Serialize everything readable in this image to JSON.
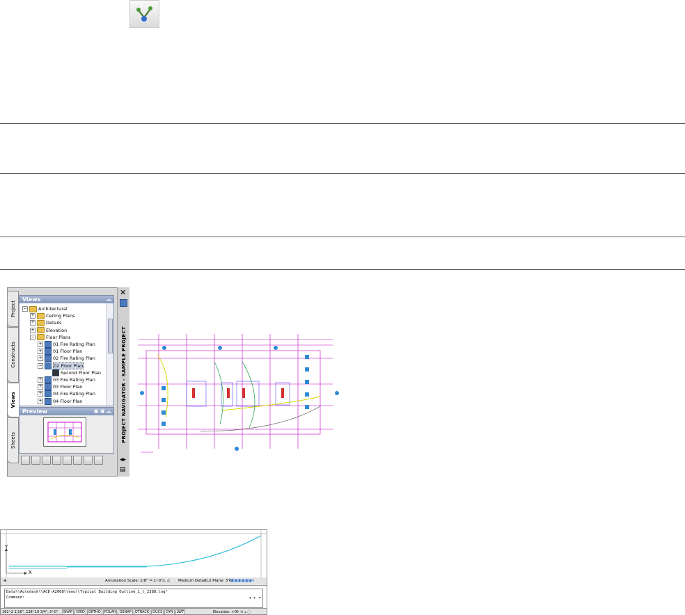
{
  "palette": {
    "tabs": [
      "Project",
      "Constructs",
      "Views",
      "Sheets"
    ],
    "active_tab": "Views",
    "views_header": "Views",
    "tree": [
      {
        "label": "Architectural",
        "indent": 0,
        "icon": "folder",
        "expander": "−"
      },
      {
        "label": "Ceiling Plans",
        "indent": 1,
        "icon": "folder",
        "expander": "+"
      },
      {
        "label": "Details",
        "indent": 1,
        "icon": "folder",
        "expander": "+"
      },
      {
        "label": "Elevation",
        "indent": 1,
        "icon": "folder",
        "expander": "+"
      },
      {
        "label": "Floor Plans",
        "indent": 1,
        "icon": "folder",
        "expander": "−"
      },
      {
        "label": "01 Fire Rating Plan",
        "indent": 2,
        "icon": "view",
        "expander": "+"
      },
      {
        "label": "01 Floor Plan",
        "indent": 2,
        "icon": "view",
        "expander": "+"
      },
      {
        "label": "02 Fire Rating Plan",
        "indent": 2,
        "icon": "view",
        "expander": "+"
      },
      {
        "label": "02 Floor Plan",
        "indent": 2,
        "icon": "view",
        "expander": "−",
        "selected": true
      },
      {
        "label": "Second Floor Plan",
        "indent": 3,
        "icon": "sheetview",
        "expander": ""
      },
      {
        "label": "03 Fire Rating Plan",
        "indent": 2,
        "icon": "view",
        "expander": "+"
      },
      {
        "label": "03 Floor Plan",
        "indent": 2,
        "icon": "view",
        "expander": "+"
      },
      {
        "label": "04 Fire Rating Plan",
        "indent": 2,
        "icon": "view",
        "expander": "+"
      },
      {
        "label": "04 Floor Plan",
        "indent": 2,
        "icon": "view",
        "expander": "+"
      }
    ],
    "preview_header": "Preview",
    "title": "PROJECT NAVIGATOR - SAMPLE PROJECT"
  },
  "cad": {
    "axis_x": "X",
    "axis_y": "Y",
    "annotation_scale": "Annotation Scale:  1/8\" = 1'-0\"",
    "display_config": "Medium Detail",
    "cut_plane": "Cut Plane:  3'6\"",
    "command_history": "Data\\\\Autodesk\\\\ACD-A2008\\\\enu\\\\Typical Building Outline_1_t_2388.log\"",
    "command_prompt": "Command:",
    "coordinates": "162'-2 1/16\", 128'-10 3/4\", 0'-0\"",
    "status_buttons": [
      "SNAP",
      "GRID",
      "ORTHO",
      "POLAR",
      "OSNAP",
      "OTRACK",
      "DUCS",
      "DYN",
      "LWT"
    ],
    "elevation": "Elevation:  +0\""
  }
}
